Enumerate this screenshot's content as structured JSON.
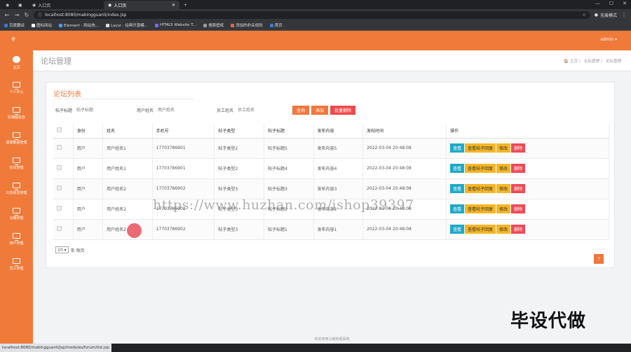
{
  "browser": {
    "tabs": [
      {
        "title": "入口页"
      },
      {
        "title": "入口页"
      }
    ],
    "url": "localhost:8080/mabingguanli/index.jsp",
    "profile": "无痕模式",
    "bookmarks": [
      "百度翻译",
      "图标网站",
      "Element - 网站快...",
      "Layui - 经典开源模...",
      "HTML5 Website T...",
      "搜索壁纸",
      "添加的命名规则",
      "首页"
    ],
    "status_url": "localhost:8080/mabingguanli/jsp/modules/forum/list.jsp"
  },
  "app": {
    "user": "admin ▾"
  },
  "sidebar": {
    "items": [
      {
        "label": "主页",
        "icon": "home-icon"
      },
      {
        "label": "个人中心",
        "icon": "monitor-icon"
      },
      {
        "label": "轮播图信息",
        "icon": "monitor-icon"
      },
      {
        "label": "基础数据管理",
        "icon": "monitor-icon"
      },
      {
        "label": "论坛管理",
        "icon": "monitor-icon"
      },
      {
        "label": "公告信息管理",
        "icon": "monitor-icon"
      },
      {
        "label": "马棚管理",
        "icon": "monitor-icon"
      },
      {
        "label": "用户管理",
        "icon": "monitor-icon"
      },
      {
        "label": "员工管理",
        "icon": "monitor-icon"
      }
    ]
  },
  "page": {
    "title": "论坛管理",
    "breadcrumb": "🏠 主页 〉 论坛管理 〉 论坛管理"
  },
  "list": {
    "title": "论坛列表",
    "search": [
      {
        "label": "帖子标题",
        "placeholder": "帖子标题"
      },
      {
        "label": "用户姓名",
        "placeholder": "用户姓名"
      },
      {
        "label": "员工姓名",
        "placeholder": "员工姓名"
      }
    ],
    "buttons": {
      "query": "查询",
      "add": "添加",
      "batch_delete": "批量删除"
    },
    "columns": [
      "身份",
      "姓名",
      "手机号",
      "帖子类型",
      "帖子标题",
      "发布内容",
      "发帖时间",
      "操作"
    ],
    "rows": [
      [
        "用户",
        "用户姓名1",
        "17703786901",
        "帖子类型2",
        "帖子标题5",
        "发布内容5",
        "2022-03-04 20:48:08"
      ],
      [
        "用户",
        "用户姓名1",
        "17703786901",
        "帖子类型2",
        "帖子标题4",
        "发布内容4",
        "2022-03-04 20:48:08"
      ],
      [
        "用户",
        "用户姓名2",
        "17703786902",
        "帖子类型3",
        "帖子标题3",
        "发布内容3",
        "2022-03-04 20:48:08"
      ],
      [
        "用户",
        "用户姓名2",
        "17703786902",
        "帖子类型3",
        "帖子标题2",
        "发布内容2",
        "2022-03-04 20:48:08"
      ],
      [
        "用户",
        "用户姓名2",
        "17703786902",
        "帖子类型3",
        "帖子标题1",
        "发布内容1",
        "2022-03-04 20:48:08"
      ]
    ],
    "row_actions": {
      "view": "查看",
      "view_reply": "查看帖子回复",
      "edit": "修改",
      "delete": "删除"
    },
    "pager": {
      "page_size": "10 ▾",
      "suffix": "条 每页"
    },
    "help_button": "?"
  },
  "footer": "欢迎使用马棚管理系统",
  "watermark": "https://www.huzhan.com/ishop39397",
  "stamp": "毕设代做"
}
